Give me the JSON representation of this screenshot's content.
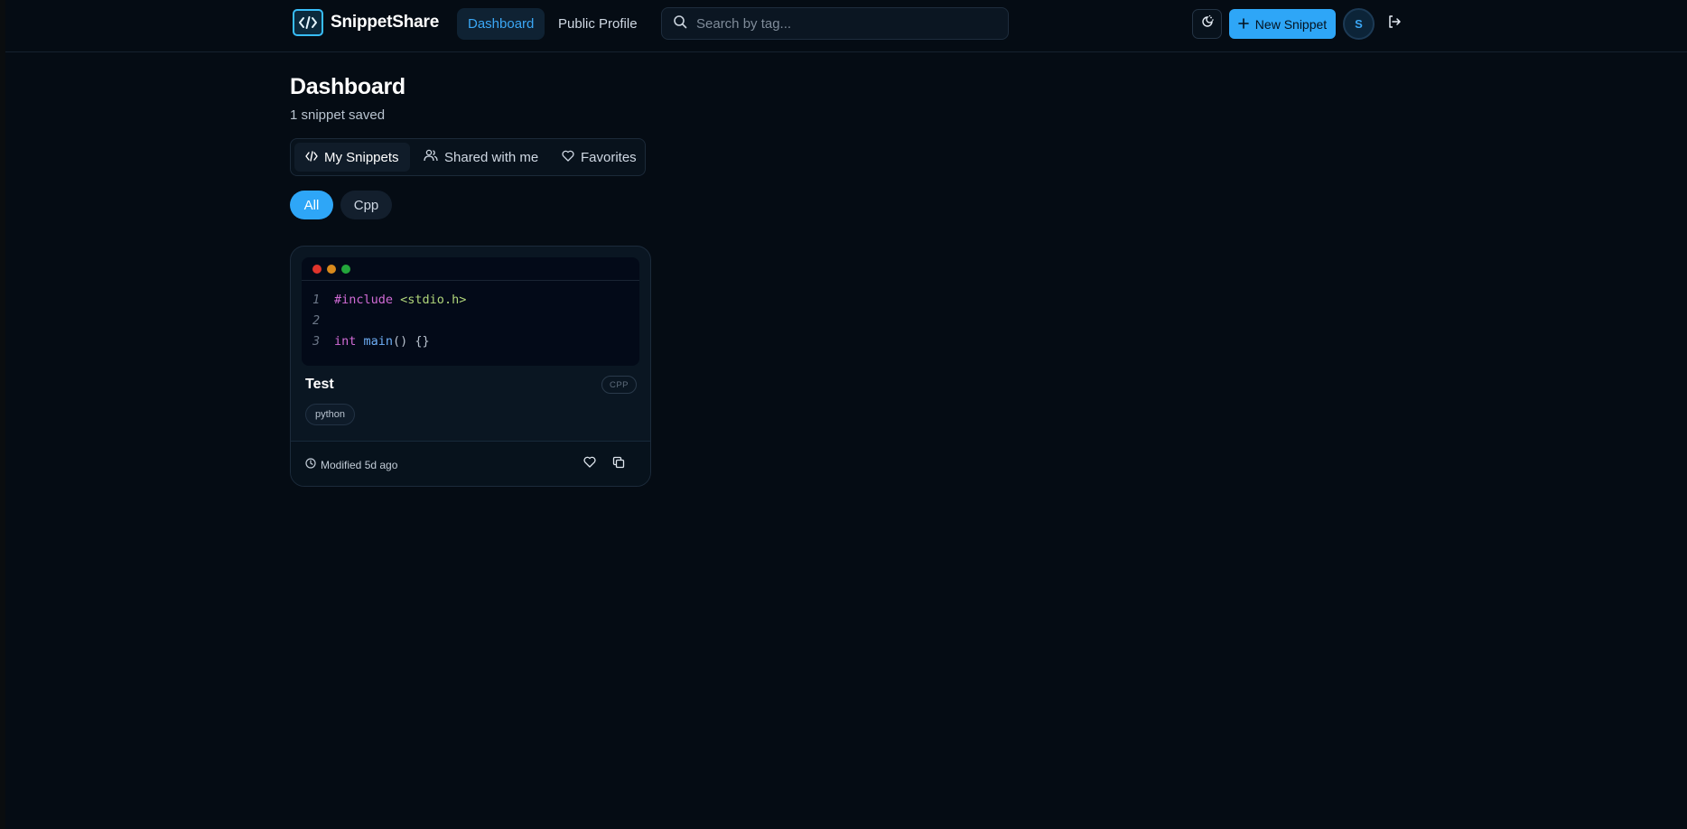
{
  "app": {
    "name": "SnippetShare",
    "logo_icon": "code-brackets-icon"
  },
  "nav": {
    "dashboard_label": "Dashboard",
    "public_profile_label": "Public Profile"
  },
  "search": {
    "placeholder": "Search by tag...",
    "icon": "search-icon"
  },
  "header_actions": {
    "theme_icon": "theme-toggle-icon",
    "new_snippet_label": "New Snippet",
    "avatar_initial": "S",
    "logout_icon": "logout-icon"
  },
  "page": {
    "title": "Dashboard",
    "subtitle": "1 snippet saved"
  },
  "tabs": [
    {
      "label": "My Snippets",
      "icon": "code-icon",
      "active": true
    },
    {
      "label": "Shared with me",
      "icon": "users-icon",
      "active": false
    },
    {
      "label": "Favorites",
      "icon": "heart-icon",
      "active": false
    }
  ],
  "filters": [
    {
      "label": "All",
      "active": true
    },
    {
      "label": "Cpp",
      "active": false
    }
  ],
  "snippets": [
    {
      "title": "Test",
      "language_badge": "CPP",
      "tags": [
        "python"
      ],
      "modified": "Modified 5d ago",
      "code_lines": [
        {
          "number": "1",
          "text": "#include <stdio.h>"
        },
        {
          "number": "2",
          "text": ""
        },
        {
          "number": "3",
          "text": "int main() {}"
        }
      ]
    }
  ],
  "colors": {
    "accent": "#2ea6f7",
    "background": "#050c14",
    "window_dot_red": "#e0342c",
    "window_dot_yellow": "#d98a1c",
    "window_dot_green": "#23a63b"
  }
}
